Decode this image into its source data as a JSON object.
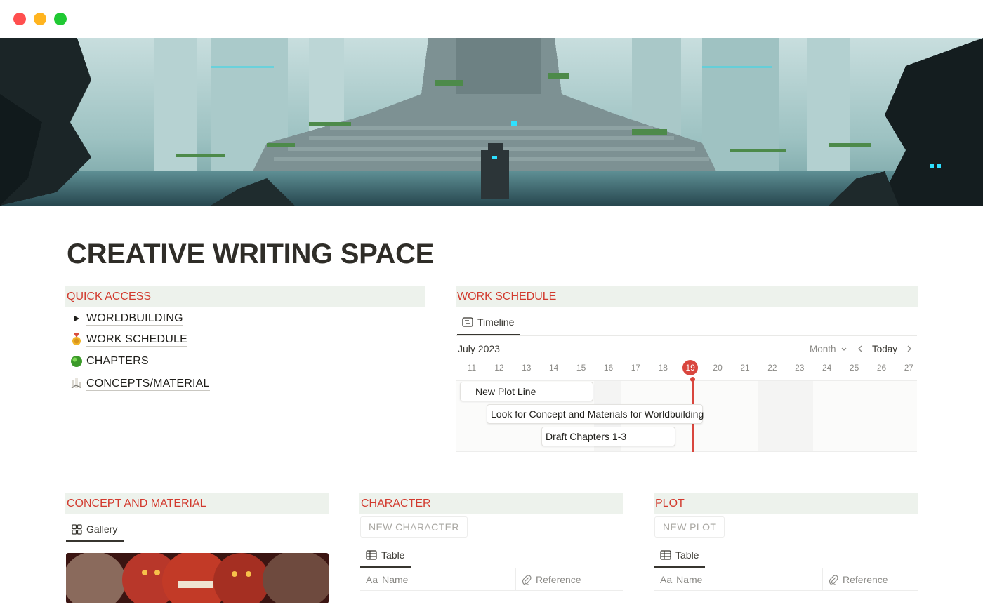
{
  "page": {
    "title": "CREATIVE WRITING SPACE"
  },
  "quick_access": {
    "heading": "QUICK ACCESS",
    "items": [
      {
        "label": "WORLDBUILDING",
        "icon": "toggle-triangle-icon"
      },
      {
        "label": "WORK SCHEDULE",
        "icon": "medal-icon"
      },
      {
        "label": "CHAPTERS",
        "icon": "green-ball-icon"
      },
      {
        "label": "CONCEPTS/MATERIAL",
        "icon": "chart-document-icon"
      }
    ]
  },
  "work_schedule": {
    "heading": "WORK SCHEDULE",
    "view_tab": "Timeline",
    "month_label": "July 2023",
    "range_selector": "Month",
    "today_button": "Today",
    "days": [
      "11",
      "12",
      "13",
      "14",
      "15",
      "16",
      "17",
      "18",
      "19",
      "20",
      "21",
      "22",
      "23",
      "24",
      "25",
      "26",
      "27"
    ],
    "current_day": "19",
    "tasks": [
      {
        "label": "New Plot Line"
      },
      {
        "label": "Look for Concept and Materials for Worldbuilding"
      },
      {
        "label": "Draft Chapters 1-3"
      }
    ],
    "accent_color": "#d9463e"
  },
  "concept_material": {
    "heading": "CONCEPT AND MATERIAL",
    "view_tab": "Gallery"
  },
  "character": {
    "heading": "CHARACTER",
    "new_button": "NEW CHARACTER",
    "view_tab": "Table",
    "columns": [
      {
        "prefix": "Aa",
        "label": "Name"
      },
      {
        "label": "Reference",
        "icon": "paperclip-icon"
      }
    ]
  },
  "plot": {
    "heading": "PLOT",
    "new_button": "NEW PLOT",
    "view_tab": "Table",
    "columns": [
      {
        "prefix": "Aa",
        "label": "Name"
      },
      {
        "label": "Reference",
        "icon": "paperclip-icon"
      }
    ]
  },
  "colors": {
    "heading_text": "#d23a2e",
    "heading_bg": "#edf2ec"
  }
}
